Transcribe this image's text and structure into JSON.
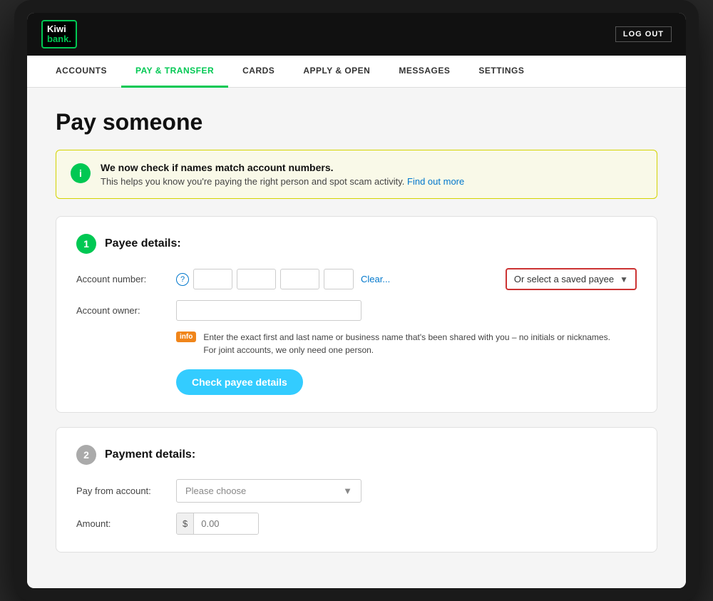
{
  "app": {
    "title": "Kiwibank",
    "logout_label": "LOG OUT"
  },
  "nav": {
    "items": [
      {
        "id": "accounts",
        "label": "ACCOUNTS",
        "active": false
      },
      {
        "id": "pay-transfer",
        "label": "PAY & TRANSFER",
        "active": true
      },
      {
        "id": "cards",
        "label": "CARDS",
        "active": false
      },
      {
        "id": "apply-open",
        "label": "APPLY & OPEN",
        "active": false
      },
      {
        "id": "messages",
        "label": "MESSAGES",
        "active": false
      },
      {
        "id": "settings",
        "label": "SETTINGS",
        "active": false
      }
    ]
  },
  "page": {
    "title": "Pay someone",
    "info_banner": {
      "heading": "We now check if names match account numbers.",
      "body": "This helps you know you're paying the right person and spot scam activity.",
      "link_text": "Find out more"
    }
  },
  "section1": {
    "step": "1",
    "title": "Payee details:",
    "account_number_label": "Account number:",
    "help_tooltip": "?",
    "clear_label": "Clear...",
    "saved_payee_label": "Or select a saved payee",
    "account_owner_label": "Account owner:",
    "info_notice": {
      "badge": "info",
      "line1": "Enter the exact first and last name or business name that's been shared with you – no initials or nicknames.",
      "line2": "For joint accounts, we only need one person."
    },
    "check_button_label": "Check payee details"
  },
  "section2": {
    "step": "2",
    "title": "Payment details:",
    "pay_from_label": "Pay from account:",
    "pay_from_placeholder": "Please choose",
    "amount_label": "Amount:",
    "amount_currency": "$",
    "amount_placeholder": "0.00"
  }
}
